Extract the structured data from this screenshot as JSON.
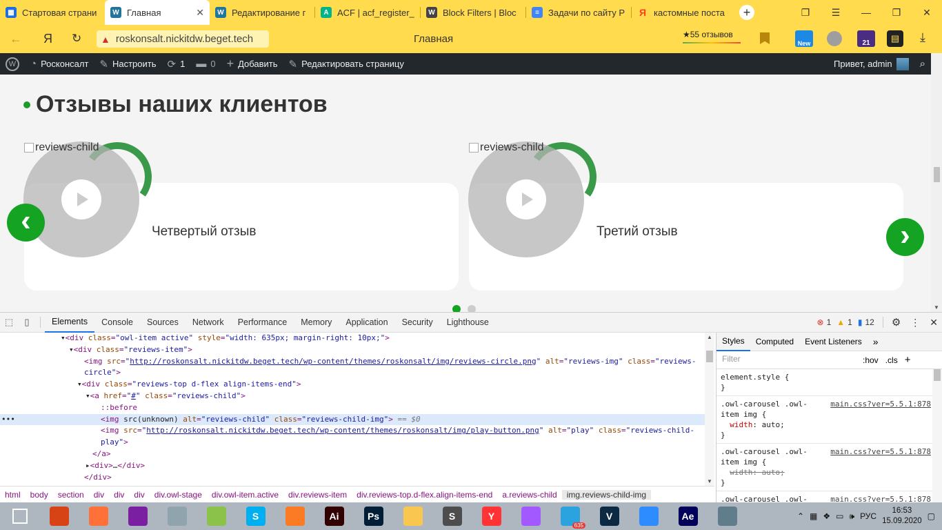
{
  "browser": {
    "tabs": [
      {
        "title": "Стартовая страни",
        "icon": "grid-icon",
        "color": "#1e6fd9",
        "active": false
      },
      {
        "title": "Главная",
        "icon": "wordpress-icon",
        "color": "#21759b",
        "active": true
      },
      {
        "title": "Редактирование г",
        "icon": "wordpress-icon",
        "color": "#21759b",
        "active": false
      },
      {
        "title": "ACF | acf_register_",
        "icon": "acf-icon",
        "color": "#00b48a",
        "active": false
      },
      {
        "title": "Block Filters | Bloc",
        "icon": "wordpress-icon",
        "color": "#444",
        "active": false
      },
      {
        "title": "Задачи по сайту Р",
        "icon": "docs-icon",
        "color": "#4285f4",
        "active": false
      },
      {
        "title": "кастомные поста",
        "icon": "yandex-icon",
        "color": "#fc3f1d",
        "active": false
      }
    ],
    "close_glyph": "✕",
    "plus_glyph": "+",
    "url": "roskonsalt.nickitdw.beget.tech",
    "page_title": "Главная",
    "reviews_badge": "★55 отзывов",
    "yandex_glyph": "Я",
    "new_badge": "New",
    "calendar_badge": "21"
  },
  "wpbar": {
    "site_name": "Росконсалт",
    "customize": "Настроить",
    "updates_count": "1",
    "comments_count": "0",
    "add_new": "Добавить",
    "edit_page": "Редактировать страницу",
    "greeting": "Привет, admin"
  },
  "page": {
    "section_title": "Отзывы наших клиентов",
    "cards": [
      {
        "alt_text": "reviews-child",
        "title": "Четвертый отзыв"
      },
      {
        "alt_text": "reviews-child",
        "title": "Третий отзыв"
      }
    ],
    "prev_glyph": "‹",
    "next_glyph": "›",
    "slider_dots": {
      "total": 2,
      "active_index": 0
    }
  },
  "devtools": {
    "tabs": [
      "Elements",
      "Console",
      "Sources",
      "Network",
      "Performance",
      "Memory",
      "Application",
      "Security",
      "Lighthouse"
    ],
    "active_tab": "Elements",
    "errors": "1",
    "warnings": "1",
    "messages": "12",
    "dom": {
      "l1_class": "owl-item active",
      "l1_style": "width: 635px; margin-right: 10px;",
      "l2_class": "reviews-item",
      "l3_src": "http://roskonsalt.nickitdw.beget.tech/wp-content/themes/roskonsalt/img/reviews-circle.png",
      "l3_alt": "reviews-img",
      "l3_class_a": "reviews-",
      "l3_class_b": "circle",
      "l5_class": "reviews-top d-flex align-items-end",
      "l6_href": "#",
      "l6_class": "reviews-child",
      "l7_pseudo": "::before",
      "l8_src": "src(unknown)",
      "l8_alt": "reviews-child",
      "l8_class": "reviews-child-img",
      "l8_suffix": "== $0",
      "l9_src": "http://roskonsalt.nickitdw.beget.tech/wp-content/themes/roskonsalt/img/play-button.png",
      "l9_alt": "play",
      "l9_class_a": "reviews-child-",
      "l9_class_b": "play",
      "ellipsis": "…",
      "dots_marker": "•••"
    },
    "styles_tabs": [
      "Styles",
      "Computed",
      "Event Listeners"
    ],
    "styles_more": "»",
    "filter_placeholder": "Filter",
    "hov": ":hov",
    "cls": ".cls",
    "rules": [
      {
        "selector": "element.style {",
        "source": ""
      },
      {
        "selector": ".owl-carousel .owl-item img {",
        "source": "main.css?ver=5.5.1:878",
        "prop": "width",
        "value": "auto",
        "struck": false
      },
      {
        "selector": ".owl-carousel .owl-item img {",
        "source": "main.css?ver=5.5.1:878",
        "prop": "width",
        "value": "auto",
        "struck": true
      },
      {
        "selector": ".owl-carousel .owl-item img {",
        "source": "main.css?ver=5.5.1:878"
      }
    ],
    "breadcrumbs": [
      "html",
      "body",
      "section",
      "div",
      "div",
      "div",
      "div.owl-stage",
      "div.owl-item.active",
      "div.reviews-item",
      "div.reviews-top.d-flex.align-items-end",
      "a.reviews-child",
      "img.reviews-child-img"
    ]
  },
  "taskbar": {
    "apps": [
      {
        "name": "windows-start-icon",
        "label": "",
        "color": "#1e88e5"
      },
      {
        "name": "ccleaner-icon",
        "label": "",
        "color": "#d84315"
      },
      {
        "name": "firefox-icon",
        "label": "",
        "color": "#ff7139"
      },
      {
        "name": "winrar-icon",
        "label": "",
        "color": "#7b1fa2"
      },
      {
        "name": "paint-icon",
        "label": "",
        "color": "#90a4ae"
      },
      {
        "name": "sticky-notes-icon",
        "label": "",
        "color": "#8bc34a"
      },
      {
        "name": "skype-icon",
        "label": "S",
        "color": "#00aff0"
      },
      {
        "name": "xampp-icon",
        "label": "",
        "color": "#fb7a24"
      },
      {
        "name": "illustrator-icon",
        "label": "Ai",
        "color": "#330000"
      },
      {
        "name": "photoshop-icon",
        "label": "Ps",
        "color": "#001e36"
      },
      {
        "name": "file-explorer-icon",
        "label": "",
        "color": "#f9c74f"
      },
      {
        "name": "sublime-text-icon",
        "label": "S",
        "color": "#4d4d4d"
      },
      {
        "name": "yandex-browser-icon",
        "label": "Y",
        "color": "#ff3333"
      },
      {
        "name": "figma-icon",
        "label": "",
        "color": "#a259ff"
      },
      {
        "name": "telegram-icon",
        "label": "",
        "color": "#2aa3df"
      },
      {
        "name": "vectorworks-icon",
        "label": "V",
        "color": "#0d2a45"
      },
      {
        "name": "zoom-icon",
        "label": "",
        "color": "#2d8cff"
      },
      {
        "name": "after-effects-icon",
        "label": "Ae",
        "color": "#00005b"
      },
      {
        "name": "vpn-icon",
        "label": "",
        "color": "#607d8b"
      }
    ],
    "telegram_badge": "635",
    "lang": "РУС",
    "time": "16:53",
    "date": "15.09.2020"
  }
}
